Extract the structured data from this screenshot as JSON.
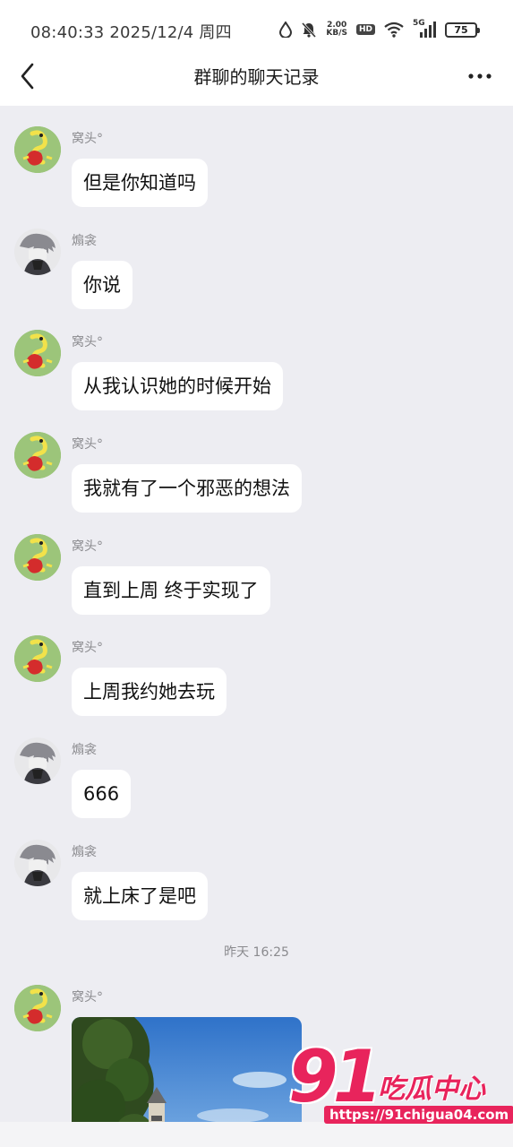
{
  "status_bar": {
    "time": "08:40:33 2025/12/4 周四",
    "net_speed_value": "2.00",
    "net_speed_unit": "KB/S",
    "hd_label": "HD",
    "network_label": "5G",
    "battery_level": "75"
  },
  "nav": {
    "title": "群聊的聊天记录",
    "back_icon": "chevron-left-icon",
    "more_icon": "more-dots-icon"
  },
  "messages": [
    {
      "sender": "窝头°",
      "text": "但是你知道吗",
      "avatar": "green-snake-avatar"
    },
    {
      "sender": "煽衾",
      "text": "你说",
      "avatar": "gray-character-avatar"
    },
    {
      "sender": "窝头°",
      "text": "从我认识她的时候开始",
      "avatar": "green-snake-avatar"
    },
    {
      "sender": "窝头°",
      "text": "我就有了一个邪恶的想法",
      "avatar": "green-snake-avatar"
    },
    {
      "sender": "窝头°",
      "text": "直到上周 终于实现了",
      "avatar": "green-snake-avatar"
    },
    {
      "sender": "窝头°",
      "text": "上周我约她去玩",
      "avatar": "green-snake-avatar"
    },
    {
      "sender": "煽衾",
      "text": "666",
      "avatar": "gray-character-avatar"
    },
    {
      "sender": "煽衾",
      "text": "就上床了是吧",
      "avatar": "gray-character-avatar"
    }
  ],
  "timestamp": "昨天 16:25",
  "last_message": {
    "sender": "窝头°",
    "avatar": "green-snake-avatar",
    "content": "photo"
  },
  "watermark": {
    "number": "91",
    "name": "吃瓜中心",
    "url": "https://91chigua04.com"
  },
  "colors": {
    "chat_background": "#ededf2",
    "bubble": "#ffffff",
    "watermark_accent": "#e8245c"
  }
}
